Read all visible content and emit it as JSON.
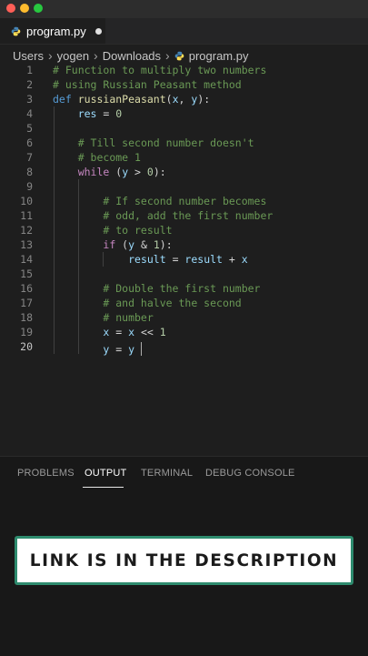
{
  "colors": {
    "close": "#ff5f57",
    "minimize": "#febc2e",
    "zoom": "#28c840",
    "python_blue": "#4584b6",
    "python_yellow": "#ffde57",
    "banner_border": "#2e8b6e"
  },
  "tab": {
    "file": "program.py",
    "icon": "python-file-icon",
    "unsaved": true
  },
  "breadcrumb": [
    "Users",
    "yogen",
    "Downloads",
    "program.py"
  ],
  "editor": {
    "active_line": 20,
    "lines": [
      {
        "n": "1",
        "tokens": [
          {
            "t": "# Function to multiply two numbers",
            "c": "com"
          }
        ]
      },
      {
        "n": "2",
        "tokens": [
          {
            "t": "# using Russian Peasant method",
            "c": "com"
          }
        ]
      },
      {
        "n": "3",
        "tokens": [
          {
            "t": "def",
            "c": "def"
          },
          {
            "t": " ",
            "c": "op"
          },
          {
            "t": "russianPeasant",
            "c": "fn"
          },
          {
            "t": "(",
            "c": "op"
          },
          {
            "t": "x",
            "c": "var"
          },
          {
            "t": ", ",
            "c": "op"
          },
          {
            "t": "y",
            "c": "var"
          },
          {
            "t": "):",
            "c": "op"
          }
        ]
      },
      {
        "n": "4",
        "tokens": [
          {
            "t": "    ",
            "c": "op"
          },
          {
            "t": "res",
            "c": "var"
          },
          {
            "t": " = ",
            "c": "op"
          },
          {
            "t": "0",
            "c": "num"
          }
        ]
      },
      {
        "n": "5",
        "tokens": []
      },
      {
        "n": "6",
        "tokens": [
          {
            "t": "    ",
            "c": "op"
          },
          {
            "t": "# Till second number doesn't",
            "c": "com"
          }
        ]
      },
      {
        "n": "7",
        "tokens": [
          {
            "t": "    ",
            "c": "op"
          },
          {
            "t": "# become 1",
            "c": "com"
          }
        ]
      },
      {
        "n": "8",
        "tokens": [
          {
            "t": "    ",
            "c": "op"
          },
          {
            "t": "while",
            "c": "kw"
          },
          {
            "t": " (",
            "c": "op"
          },
          {
            "t": "y",
            "c": "var"
          },
          {
            "t": " > ",
            "c": "op"
          },
          {
            "t": "0",
            "c": "num"
          },
          {
            "t": "):",
            "c": "op"
          }
        ]
      },
      {
        "n": "9",
        "tokens": []
      },
      {
        "n": "10",
        "tokens": [
          {
            "t": "        ",
            "c": "op"
          },
          {
            "t": "# If second number becomes",
            "c": "com"
          }
        ]
      },
      {
        "n": "11",
        "tokens": [
          {
            "t": "        ",
            "c": "op"
          },
          {
            "t": "# odd, add the first number",
            "c": "com"
          }
        ]
      },
      {
        "n": "12",
        "tokens": [
          {
            "t": "        ",
            "c": "op"
          },
          {
            "t": "# to result",
            "c": "com"
          }
        ]
      },
      {
        "n": "13",
        "tokens": [
          {
            "t": "        ",
            "c": "op"
          },
          {
            "t": "if",
            "c": "kw"
          },
          {
            "t": " (",
            "c": "op"
          },
          {
            "t": "y",
            "c": "var"
          },
          {
            "t": " & ",
            "c": "op"
          },
          {
            "t": "1",
            "c": "num"
          },
          {
            "t": "):",
            "c": "op"
          }
        ]
      },
      {
        "n": "14",
        "tokens": [
          {
            "t": "            ",
            "c": "op"
          },
          {
            "t": "result",
            "c": "var"
          },
          {
            "t": " = ",
            "c": "op"
          },
          {
            "t": "result",
            "c": "var"
          },
          {
            "t": " + ",
            "c": "op"
          },
          {
            "t": "x",
            "c": "var"
          }
        ]
      },
      {
        "n": "15",
        "tokens": []
      },
      {
        "n": "16",
        "tokens": [
          {
            "t": "        ",
            "c": "op"
          },
          {
            "t": "# Double the first number",
            "c": "com"
          }
        ]
      },
      {
        "n": "17",
        "tokens": [
          {
            "t": "        ",
            "c": "op"
          },
          {
            "t": "# and halve the second",
            "c": "com"
          }
        ]
      },
      {
        "n": "18",
        "tokens": [
          {
            "t": "        ",
            "c": "op"
          },
          {
            "t": "# number",
            "c": "com"
          }
        ]
      },
      {
        "n": "19",
        "tokens": [
          {
            "t": "        ",
            "c": "op"
          },
          {
            "t": "x",
            "c": "var"
          },
          {
            "t": " = ",
            "c": "op"
          },
          {
            "t": "x",
            "c": "var"
          },
          {
            "t": " << ",
            "c": "op"
          },
          {
            "t": "1",
            "c": "num"
          }
        ]
      },
      {
        "n": "20",
        "tokens": [
          {
            "t": "        ",
            "c": "op"
          },
          {
            "t": "y",
            "c": "var"
          },
          {
            "t": " = ",
            "c": "op"
          },
          {
            "t": "y",
            "c": "var"
          },
          {
            "t": " ",
            "c": "op"
          }
        ]
      }
    ]
  },
  "panel": {
    "tabs": [
      "PROBLEMS",
      "OUTPUT",
      "TERMINAL",
      "DEBUG CONSOLE"
    ],
    "active": "OUTPUT"
  },
  "banner": {
    "text": "LINK IS IN THE DESCRIPTION"
  }
}
